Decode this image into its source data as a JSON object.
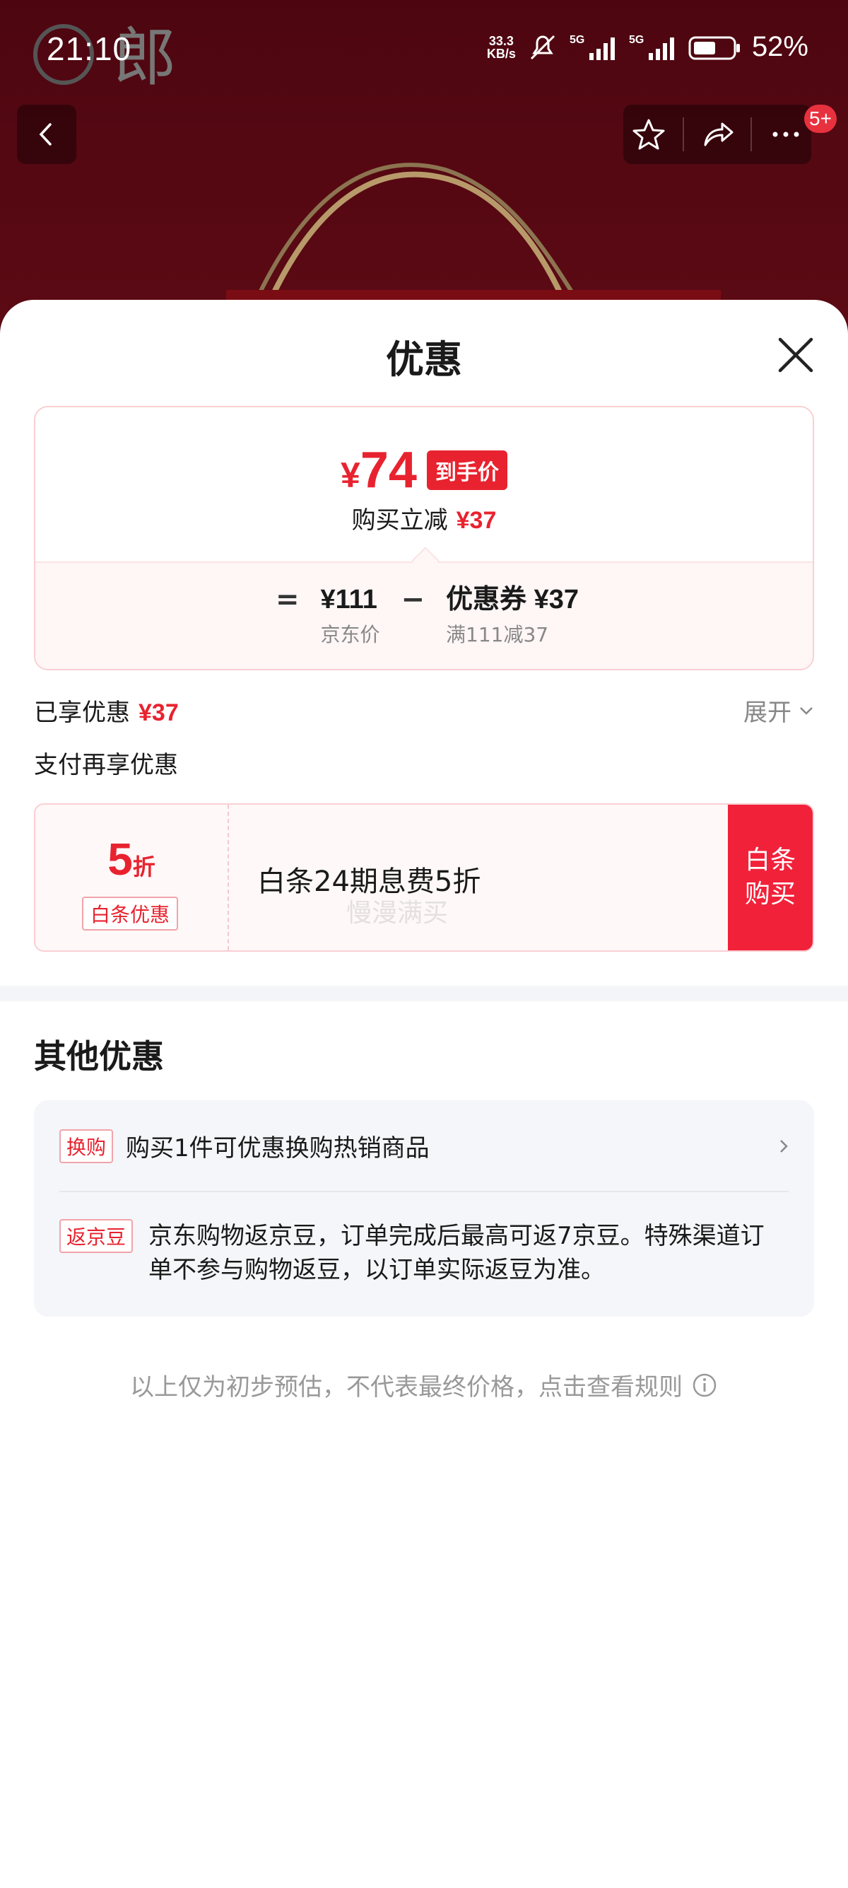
{
  "status_bar": {
    "time": "21:10",
    "net_speed_value": "33.3",
    "net_speed_unit": "KB/s",
    "battery_percent": "52%",
    "signal1_label": "5G",
    "signal2_label": "5G"
  },
  "nav": {
    "badge": "5+"
  },
  "sheet": {
    "title": "优惠",
    "price_card": {
      "final_currency": "¥",
      "final_price": "74",
      "final_tag": "到手价",
      "reduce_label": "购买立减",
      "reduce_value": "¥37",
      "equals": "=",
      "jd_price": "¥111",
      "jd_price_label": "京东价",
      "minus": "−",
      "coupon": "优惠券 ¥37",
      "coupon_rule": "满111减37"
    },
    "enjoyed_label": "已享优惠",
    "enjoyed_value": "¥37",
    "expand_label": "展开",
    "pay_title": "支付再享优惠",
    "baitiao": {
      "discount_number": "5",
      "discount_unit": "折",
      "tag": "白条优惠",
      "description": "白条24期息费5折",
      "watermark": "慢漫满买",
      "button": "白条购买"
    },
    "other_title": "其他优惠",
    "other_items": [
      {
        "tag": "换购",
        "text": "购买1件可优惠换购热销商品"
      },
      {
        "tag": "返京豆",
        "text": "京东购物返京豆，订单完成后最高可返7京豆。特殊渠道订单不参与购物返豆，以订单实际返豆为准。"
      }
    ],
    "footnote": "以上仅为初步预估，不代表最终价格，点击查看规则"
  },
  "colors": {
    "accent_red": "#e8232f",
    "button_red": "#f2213a",
    "header_bg": "#4d0610"
  },
  "icons": [
    "brand-logo",
    "silent-icon",
    "signal-icon",
    "battery-icon",
    "back-icon",
    "star-icon",
    "share-icon",
    "more-icon",
    "close-icon",
    "chevron-down-icon",
    "chevron-right-icon",
    "info-icon"
  ]
}
